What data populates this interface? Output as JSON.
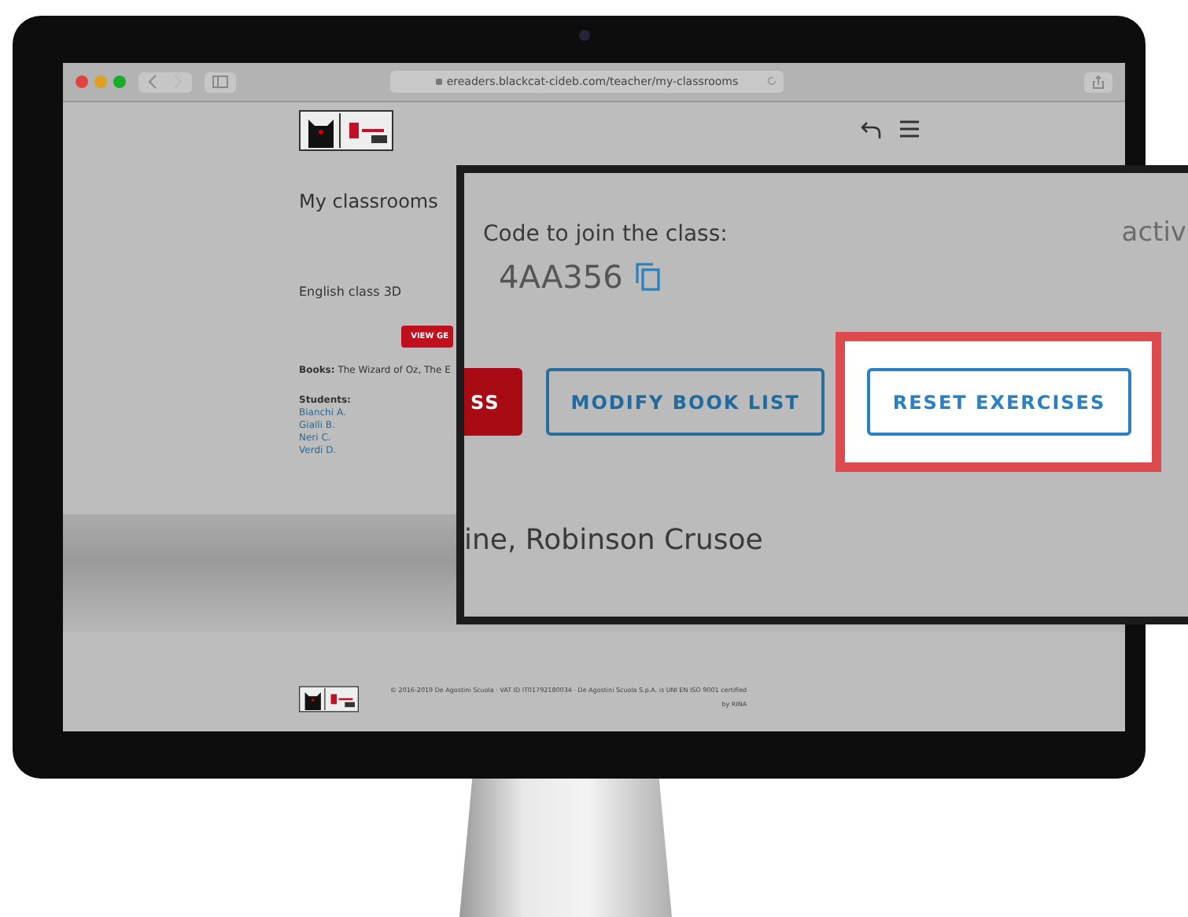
{
  "browser": {
    "url": "ereaders.blackcat-cideb.com/teacher/my-classrooms"
  },
  "page": {
    "heading": "My classrooms",
    "class_name": "English class 3D",
    "view_button": "VIEW GE",
    "books_label": "Books:",
    "books": "The Wizard of Oz, The E",
    "students_label": "Students:",
    "students": [
      "Bianchi A.",
      "Gialli B.",
      "Neri C.",
      "Verdi D."
    ],
    "footer": {
      "copyright": "© 2016-2019 De Agostini Scuola · VAT ID IT01792180034 · De Agostini Scuola S.p.A. is UNI EN ISO 9001 certified",
      "certifier": "by RINA"
    }
  },
  "callout": {
    "code_label": "Code to join the class:",
    "code": "4AA356",
    "status": "activ",
    "buttons": [
      {
        "label": "SS",
        "kind": "filled",
        "highlighted": false
      },
      {
        "label": "MODIFY BOOK LIST",
        "kind": "outline",
        "highlighted": false
      },
      {
        "label": "RESET EXERCISES",
        "kind": "outline",
        "highlighted": true
      }
    ],
    "books_tail": "ine, Robinson Crusoe"
  }
}
